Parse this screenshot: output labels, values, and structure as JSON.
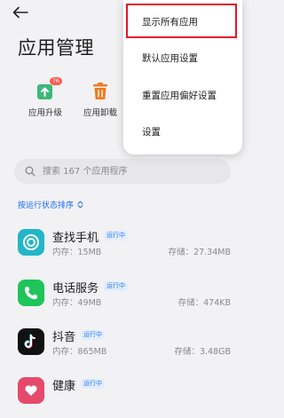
{
  "header": {
    "title": "应用管理"
  },
  "shortcuts": [
    {
      "label": "应用升级",
      "badge": "76",
      "icon": "upgrade-icon",
      "color": "#3cb878"
    },
    {
      "label": "应用卸载",
      "icon": "trash-icon",
      "color": "#f07a1e"
    }
  ],
  "search": {
    "placeholder": "搜索 167 个应用程序"
  },
  "sort": {
    "label": "按运行状态排序"
  },
  "apps": [
    {
      "name": "查找手机",
      "status": "运行中",
      "memory": "内存：15MB",
      "storage": "存储：27.34MB",
      "icon": "find-phone-icon",
      "color": "#23b5c8"
    },
    {
      "name": "电话服务",
      "status": "运行中",
      "memory": "内存：49MB",
      "storage": "存储：474KB",
      "icon": "phone-icon",
      "color": "#1fc45a"
    },
    {
      "name": "抖音",
      "status": "运行中",
      "memory": "内存：865MB",
      "storage": "存储：3.48GB",
      "icon": "tiktok-icon",
      "color": "#111111"
    },
    {
      "name": "健康",
      "status": "运行中",
      "icon": "health-icon",
      "color": "#e64a6a"
    }
  ],
  "menu": {
    "items": [
      {
        "label": "显示所有应用"
      },
      {
        "label": "默认应用设置"
      },
      {
        "label": "重置应用偏好设置"
      },
      {
        "label": "设置"
      }
    ]
  },
  "colors": {
    "accent": "#1a6ef5",
    "highlight": "#e3152b",
    "background": "#f2f2f4"
  }
}
